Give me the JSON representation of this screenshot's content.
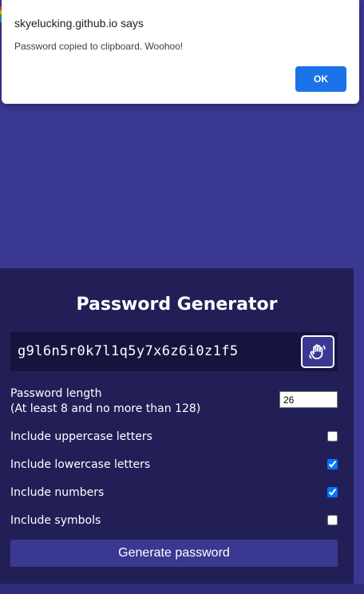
{
  "alert": {
    "origin": "skyelucking.github.io says",
    "message": "Password copied to clipboard. Woohoo!",
    "ok_label": "OK"
  },
  "generator": {
    "title": "Password Generator",
    "password": "g9l6n5r0k7l1q5y7x6z6i0z1f5",
    "copy_icon": "hand-wave-icon",
    "length_label_line1": "Password length",
    "length_label_line2": "(At least 8 and no more than 128)",
    "length_value": "26",
    "options": [
      {
        "label": "Include uppercase letters",
        "checked": false
      },
      {
        "label": "Include lowercase letters",
        "checked": true
      },
      {
        "label": "Include numbers",
        "checked": true
      },
      {
        "label": "Include symbols",
        "checked": false
      }
    ],
    "generate_label": "Generate password"
  },
  "colors": {
    "page_background": "#3b3891",
    "card_background": "#221f57",
    "password_box": "#16143e",
    "dialog_button": "#1a73e8",
    "checkbox_accent": "#0075ff"
  }
}
